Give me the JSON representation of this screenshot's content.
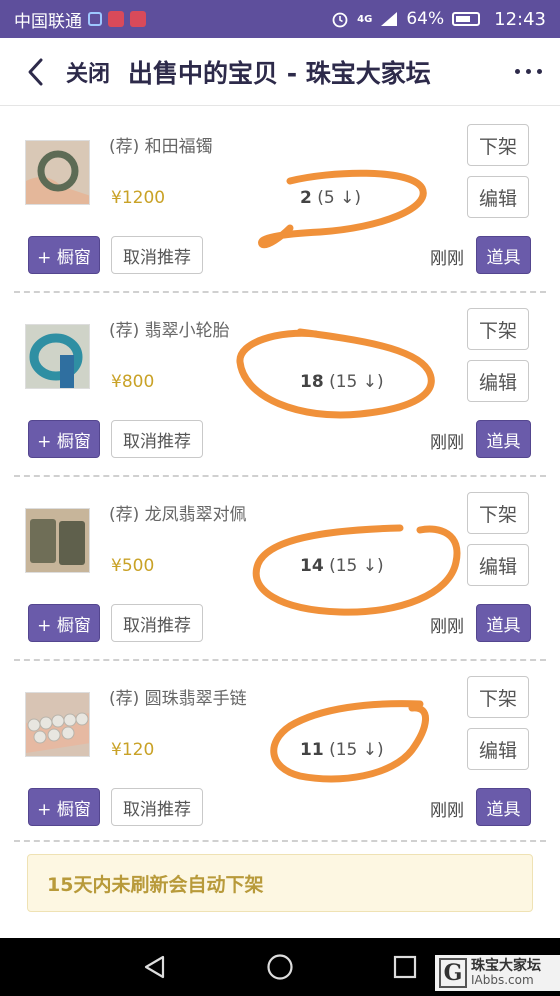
{
  "status_bar": {
    "carrier": "中国联通",
    "battery": "64%",
    "time": "12:43",
    "network": "4G"
  },
  "header": {
    "close_label": "关闭",
    "title": "出售中的宝贝 - 珠宝大家坛"
  },
  "items": [
    {
      "title": "(荐) 和田福镯",
      "price": "¥1200",
      "count_main": "2",
      "count_sub": "(5 ↓)",
      "delist_label": "下架",
      "edit_label": "编辑",
      "window_label": "+ 橱窗",
      "cancel_label": "取消推荐",
      "time": "刚刚",
      "tool_label": "道具",
      "thumb_color": "#7a8a6e"
    },
    {
      "title": "(荐) 翡翠小轮胎",
      "price": "¥800",
      "count_main": "18",
      "count_sub": "(15 ↓)",
      "delist_label": "下架",
      "edit_label": "编辑",
      "window_label": "+ 橱窗",
      "cancel_label": "取消推荐",
      "time": "刚刚",
      "tool_label": "道具",
      "thumb_color": "#3e8a9a"
    },
    {
      "title": "(荐) 龙凤翡翠对佩",
      "price": "¥500",
      "count_main": "14",
      "count_sub": "(15 ↓)",
      "delist_label": "下架",
      "edit_label": "编辑",
      "window_label": "+ 橱窗",
      "cancel_label": "取消推荐",
      "time": "刚刚",
      "tool_label": "道具",
      "thumb_color": "#7d7a66"
    },
    {
      "title": "(荐) 圆珠翡翠手链",
      "price": "¥120",
      "count_main": "11",
      "count_sub": "(15 ↓)",
      "delist_label": "下架",
      "edit_label": "编辑",
      "window_label": "+ 橱窗",
      "cancel_label": "取消推荐",
      "time": "刚刚",
      "tool_label": "道具",
      "thumb_color": "#b9b3ad"
    }
  ],
  "notice": "15天内未刷新会自动下架",
  "watermark": {
    "letter": "G",
    "line1": "珠宝大家坛",
    "line2": "IAbbs.com"
  },
  "colors": {
    "status_bar": "#5e4f9c",
    "accent_button": "#6a5baa",
    "price": "#c9a227",
    "annotation": "#f0913a"
  }
}
